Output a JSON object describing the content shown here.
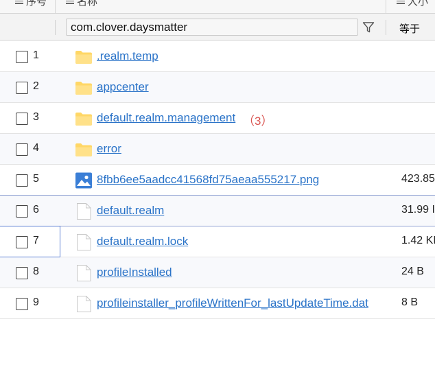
{
  "header": {
    "col_index_label": "序号",
    "col_name_label": "名称",
    "col_size_label": "大小"
  },
  "filter": {
    "name_value": "com.clover.daysmatter",
    "operator": "等于"
  },
  "colors": {
    "link": "#2a73c8",
    "count": "#d9534f",
    "folder": "#ffd766",
    "image_icon": "#3b7fd6",
    "selection_border": "#5b7fd3"
  },
  "rows": [
    {
      "index": "1",
      "name": ".realm.temp",
      "type": "folder-icon",
      "count": "",
      "size": ""
    },
    {
      "index": "2",
      "name": "appcenter",
      "type": "folder-icon",
      "count": "",
      "size": ""
    },
    {
      "index": "3",
      "name": "default.realm.management",
      "type": "folder-icon",
      "count": "（3）",
      "size": ""
    },
    {
      "index": "4",
      "name": "error",
      "type": "folder-icon",
      "count": "",
      "size": ""
    },
    {
      "index": "5",
      "name": "8fbb6ee5aadcc41568fd75aeaa555217.png",
      "type": "image-file-icon",
      "count": "",
      "size": "423.85"
    },
    {
      "index": "6",
      "name": "default.realm",
      "type": "file-icon",
      "count": "",
      "size": "31.99 I"
    },
    {
      "index": "7",
      "name": "default.realm.lock",
      "type": "file-icon",
      "count": "",
      "size": "1.42 KI"
    },
    {
      "index": "8",
      "name": "profileInstalled",
      "type": "file-icon",
      "count": "",
      "size": "24 B"
    },
    {
      "index": "9",
      "name": "profileinstaller_profileWrittenFor_lastUpdateTime.dat",
      "type": "file-icon",
      "count": "",
      "size": "8 B"
    }
  ]
}
